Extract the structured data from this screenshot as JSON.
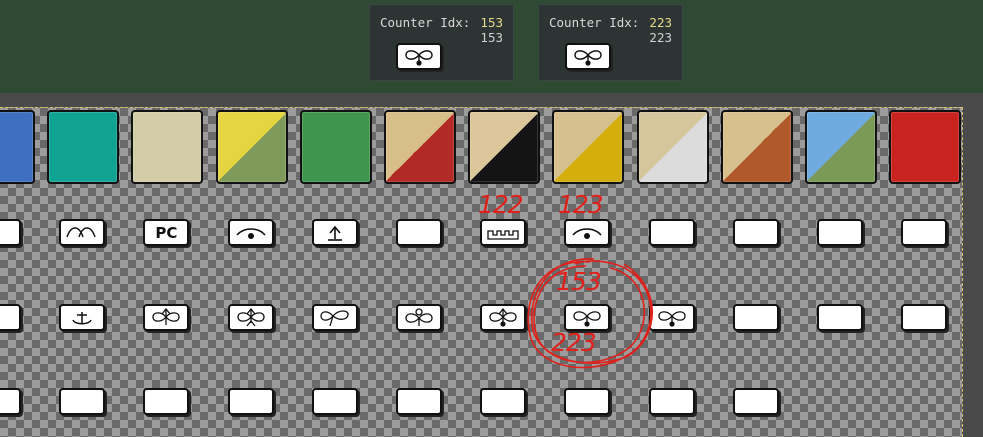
{
  "tooltips": [
    {
      "label": "Counter Idx:",
      "value_primary": "153",
      "value_secondary": "153",
      "icon": "propeller-landmark-icon"
    },
    {
      "label": "Counter Idx:",
      "value_primary": "223",
      "value_secondary": "223",
      "icon": "propeller-landmark-icon"
    }
  ],
  "swatch_row": {
    "colors": [
      "#3f6fbf",
      "#10a394",
      "#d2cda6",
      [
        "#e6d543",
        "#7f9a5b"
      ],
      "#3f944e",
      [
        "#d8be88",
        "#b22a25"
      ],
      [
        "#dbc79b",
        "#141414"
      ],
      [
        "#d6c08f",
        "#d4ae0d"
      ],
      [
        "#d6c69c",
        "#dcdcdc"
      ],
      [
        "#d8bf8e",
        "#b05a2c"
      ],
      [
        "#6faade",
        "#7a9a55"
      ],
      "#c8231e"
    ]
  },
  "counter_rows": {
    "row1": [
      {
        "icon": "partial-icon",
        "text": ""
      },
      {
        "icon": "arcs-icon",
        "text": ""
      },
      {
        "icon": "",
        "text": "PC"
      },
      {
        "icon": "eye-icon",
        "text": ""
      },
      {
        "icon": "up-arrow-icon",
        "text": ""
      },
      {
        "icon": "",
        "text": ""
      },
      {
        "icon": "battlement-icon",
        "text": ""
      },
      {
        "icon": "eye-icon",
        "text": ""
      },
      {
        "icon": "",
        "text": ""
      },
      {
        "icon": "",
        "text": ""
      },
      {
        "icon": "",
        "text": ""
      },
      {
        "icon": "",
        "text": ""
      }
    ],
    "row2": [
      {
        "icon": "partial-anchor-icon"
      },
      {
        "icon": "anchor-icon"
      },
      {
        "icon": "propeller-up-icon"
      },
      {
        "icon": "propeller-man-icon"
      },
      {
        "icon": "propeller-tilted-icon"
      },
      {
        "icon": "propeller-circle-icon"
      },
      {
        "icon": "propeller-up-dot-icon"
      },
      {
        "icon": "propeller-landmark-icon"
      },
      {
        "icon": "propeller-landmark-icon"
      },
      {
        "icon": "blank-icon"
      },
      {
        "icon": "blank-icon"
      },
      {
        "icon": "blank-icon"
      }
    ],
    "row3_count": 10
  },
  "annotations": {
    "label_122": "122",
    "label_123": "123",
    "label_153": "153",
    "label_223": "223",
    "color": "#e0201a"
  }
}
